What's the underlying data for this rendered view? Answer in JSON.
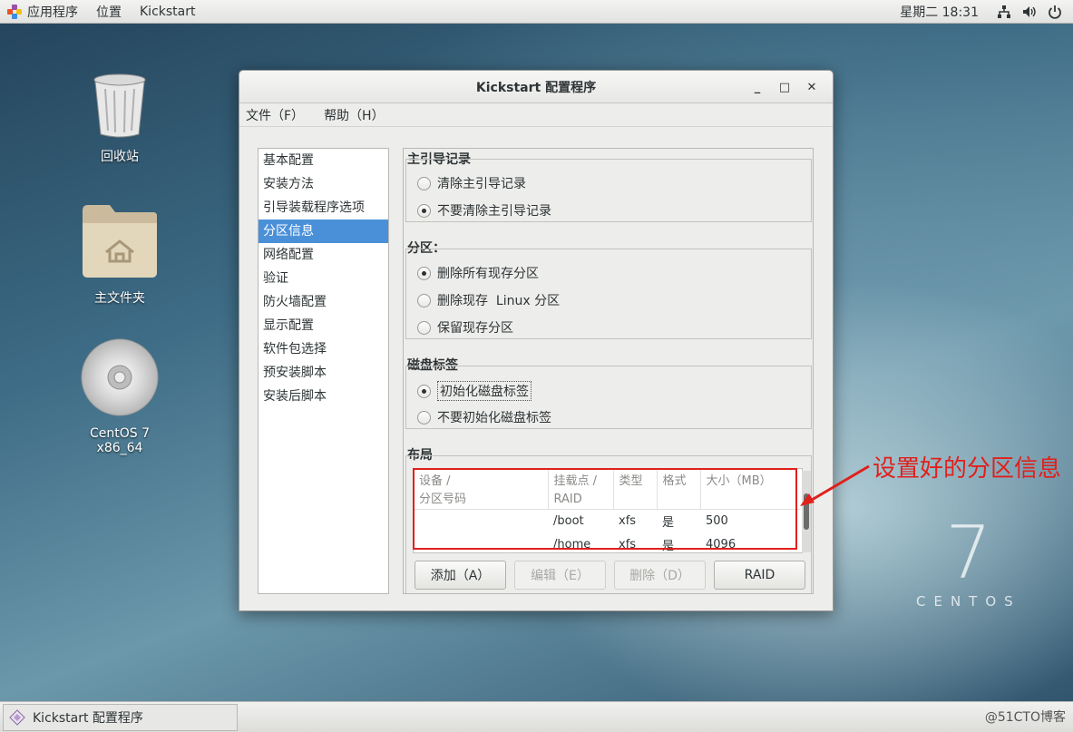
{
  "topbar": {
    "apps": "应用程序",
    "places": "位置",
    "app_name": "Kickstart",
    "clock": "星期二 18:31"
  },
  "desktop": {
    "trash": "回收站",
    "home": "主文件夹",
    "disc": "CentOS 7 x86_64"
  },
  "window": {
    "title": "Kickstart 配置程序",
    "controls": {
      "minimize": "_",
      "maximize": "□",
      "close": "✕"
    },
    "menu": [
      "文件（F）",
      "帮助（H）"
    ],
    "nav": [
      "基本配置",
      "安装方法",
      "引导装载程序选项",
      "分区信息",
      "网络配置",
      "验证",
      "防火墙配置",
      "显示配置",
      "软件包选择",
      "预安装脚本",
      "安装后脚本"
    ],
    "nav_selected": "分区信息",
    "mbr": {
      "title": "主引导记录",
      "options": [
        "清除主引导记录",
        "不要清除主引导记录"
      ],
      "selected": 1
    },
    "partitions": {
      "title": "分区：",
      "options": [
        "删除所有现存分区",
        "删除现存  Linux 分区",
        "保留现存分区"
      ],
      "selected": 0
    },
    "disklabel": {
      "title": "磁盘标签",
      "options": [
        "初始化磁盘标签",
        "不要初始化磁盘标签"
      ],
      "selected": 0
    },
    "layout": {
      "title": "布局",
      "columns": [
        "设备 /\n分区号码",
        "挂载点 /\nRAID",
        "类型",
        "格式",
        "大小（MB）"
      ],
      "rows": [
        [
          "",
          "/boot",
          "xfs",
          "是",
          "500"
        ],
        [
          "",
          "/home",
          "xfs",
          "是",
          "4096"
        ]
      ]
    },
    "buttons": {
      "add": "添加（A）",
      "edit": "编辑（E）",
      "delete": "删除（D）",
      "raid": "RAID"
    }
  },
  "annotation": "设置好的分区信息",
  "centos": {
    "seven": "7",
    "word": "CENTOS"
  },
  "taskbar": {
    "item": "Kickstart 配置程序",
    "watermark": "@51CTO博客"
  },
  "colors": {
    "selection": "#4a90d9",
    "annotation": "#e0201c"
  }
}
